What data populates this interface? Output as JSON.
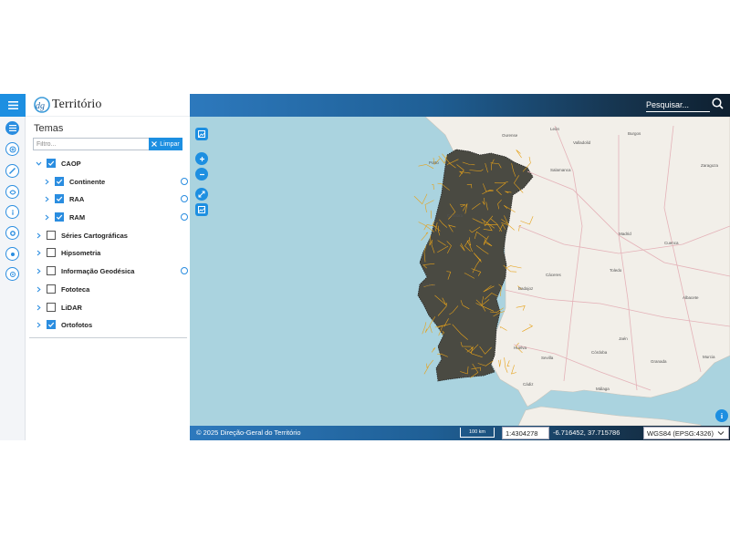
{
  "header": {
    "logo_text": "Território",
    "search_placeholder": "Pesquisar..."
  },
  "panel": {
    "title": "Temas",
    "filter_placeholder": "Filtro...",
    "clear_label": "Limpar",
    "layers": [
      {
        "label": "CAOP",
        "level": 0,
        "expanded": true,
        "checked": true,
        "gear": false
      },
      {
        "label": "Continente",
        "level": 1,
        "expanded": false,
        "checked": true,
        "gear": true
      },
      {
        "label": "RAA",
        "level": 1,
        "expanded": false,
        "checked": true,
        "gear": true
      },
      {
        "label": "RAM",
        "level": 1,
        "expanded": false,
        "checked": true,
        "gear": true
      },
      {
        "label": "Séries Cartográficas",
        "level": 0,
        "expanded": false,
        "checked": false,
        "gear": false
      },
      {
        "label": "Hipsometria",
        "level": 0,
        "expanded": false,
        "checked": false,
        "gear": false
      },
      {
        "label": "Informação Geodésica",
        "level": 0,
        "expanded": false,
        "checked": false,
        "gear": true
      },
      {
        "label": "Fototeca",
        "level": 0,
        "expanded": false,
        "checked": false,
        "gear": false
      },
      {
        "label": "LiDAR",
        "level": 0,
        "expanded": false,
        "checked": false,
        "gear": false
      },
      {
        "label": "Ortofotos",
        "level": 0,
        "expanded": false,
        "checked": true,
        "gear": false
      }
    ]
  },
  "rail_icons": [
    "layers-icon",
    "add-layer-icon",
    "measure-icon",
    "draw-icon",
    "info-icon",
    "settings-icon",
    "share-icon",
    "help-icon"
  ],
  "map": {
    "labels": [
      "Porto",
      "Coimbra",
      "Lisboa",
      "Faro",
      "Salamanca",
      "Madrid",
      "Cáceres",
      "Sevilla",
      "Córdoba",
      "Málaga",
      "Huelva",
      "Cádiz",
      "Valladolid",
      "Ourense",
      "Badajoz",
      "Toledo",
      "Jaén",
      "Granada",
      "León",
      "Burgos",
      "Zaragoza",
      "Cuenca",
      "Albacete",
      "Murcia"
    ],
    "info_button": "i"
  },
  "footer": {
    "copyright": "© 2025 Direção-Geral do Território",
    "scale_bar_label": "100 km",
    "scale": "1:4304278",
    "coordinates": "-6.716452, 37.715786",
    "crs": "WGS84 (EPSG:4326)"
  },
  "colors": {
    "accent": "#1d8fe1",
    "sea": "#aad3df",
    "land": "#f2efe9",
    "boundary": "#e6a21a",
    "portugal_fill": "#4a4a42"
  }
}
